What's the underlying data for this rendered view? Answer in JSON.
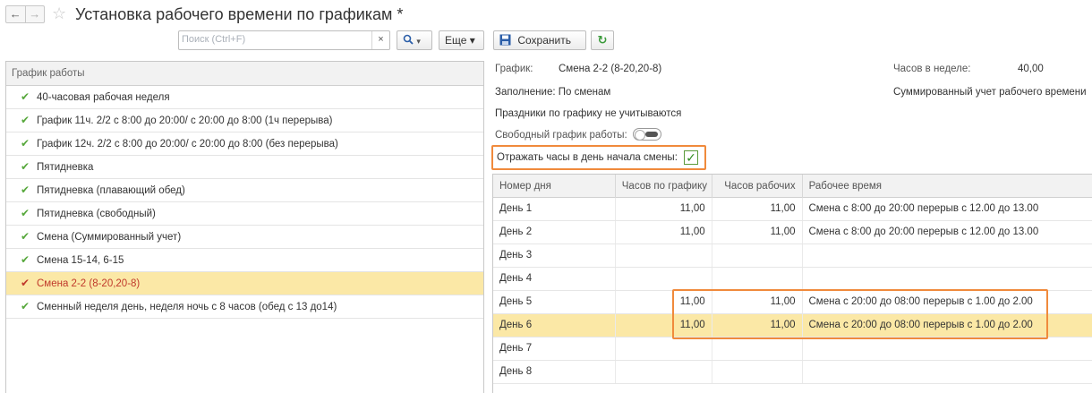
{
  "window": {
    "back_arrow": "←",
    "forward_arrow": "→",
    "star": "☆",
    "title": "Установка рабочего времени по графикам *"
  },
  "toolbar_left": {
    "search_placeholder": "Поиск (Ctrl+F)",
    "clear_label": "×",
    "search_btn": "🔍 ▾",
    "more_label": "Еще ▾"
  },
  "toolbar_right": {
    "save_label": "Сохранить",
    "refresh_icon": "↻"
  },
  "schedule_list": {
    "header": "График работы",
    "items": [
      {
        "label": "40-часовая рабочая неделя",
        "selected": false
      },
      {
        "label": "График 11ч. 2/2 с 8:00 до 20:00/ с 20:00 до 8:00 (1ч перерыва)",
        "selected": false
      },
      {
        "label": "График 12ч. 2/2 с 8:00 до 20:00/ с 20:00 до 8:00 (без перерыва)",
        "selected": false
      },
      {
        "label": "Пятидневка",
        "selected": false
      },
      {
        "label": "Пятидневка (плавающий обед)",
        "selected": false
      },
      {
        "label": "Пятидневка (свободный)",
        "selected": false
      },
      {
        "label": "Смена (Суммированный учет)",
        "selected": false
      },
      {
        "label": "Смена 15-14, 6-15",
        "selected": false
      },
      {
        "label": "Смена 2-2 (8-20,20-8)",
        "selected": true
      },
      {
        "label": "Сменный неделя день, неделя ночь с 8 часов (обед с 13 до14)",
        "selected": false
      }
    ],
    "check_glyph": "✔"
  },
  "details": {
    "schedule_label": "График:",
    "schedule_value": "Смена 2-2 (8-20,20-8)",
    "hours_week_label": "Часов в неделе:",
    "hours_week_value": "40,00",
    "fill_label": "Заполнение: По сменам",
    "summed_label": "Суммированный учет рабочего времени",
    "holidays_text": "Праздники по графику не учитываются",
    "free_schedule_label": "Свободный график работы:",
    "free_schedule_on": false,
    "reflect_hours_label": "Отражать часы в день начала смены:",
    "reflect_hours_checked": true,
    "check_glyph": "✓"
  },
  "table": {
    "columns": [
      "Номер дня",
      "Часов по графику",
      "Часов рабочих",
      "Рабочее время"
    ],
    "rows": [
      {
        "day": "День 1",
        "sched": "11,00",
        "work": "11,00",
        "time": "Смена с 8:00 до 20:00 перерыв с 12.00 до 13.00",
        "selected": false
      },
      {
        "day": "День 2",
        "sched": "11,00",
        "work": "11,00",
        "time": "Смена с 8:00 до 20:00 перерыв с 12.00 до 13.00",
        "selected": false
      },
      {
        "day": "День 3",
        "sched": "",
        "work": "",
        "time": "",
        "selected": false
      },
      {
        "day": "День 4",
        "sched": "",
        "work": "",
        "time": "",
        "selected": false
      },
      {
        "day": "День 5",
        "sched": "11,00",
        "work": "11,00",
        "time": "Смена с 20:00 до 08:00 перерыв с 1.00 до 2.00",
        "selected": false
      },
      {
        "day": "День 6",
        "sched": "11,00",
        "work": "11,00",
        "time": "Смена с 20:00 до 08:00 перерыв с 1.00 до 2.00",
        "selected": true
      },
      {
        "day": "День 7",
        "sched": "",
        "work": "",
        "time": "",
        "selected": false
      },
      {
        "day": "День 8",
        "sched": "",
        "work": "",
        "time": "",
        "selected": false
      }
    ]
  },
  "colors": {
    "highlight": "#f08a3c",
    "selected_row": "#fbe8a6",
    "check_green": "#57a83c"
  }
}
